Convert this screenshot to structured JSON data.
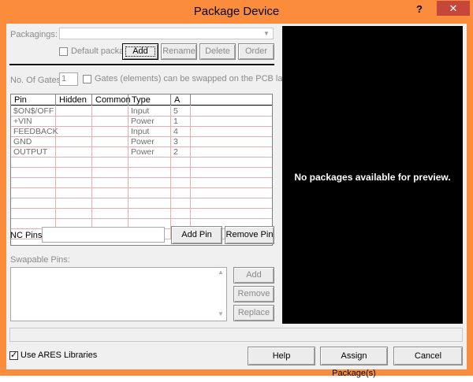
{
  "window": {
    "title": "Package Device",
    "help_symbol": "?",
    "close_symbol": "✕"
  },
  "packagings": {
    "label": "Packagings:",
    "value": "",
    "default_package_label": "Default package",
    "buttons": {
      "add": "Add",
      "rename": "Rename",
      "delete": "Delete",
      "order": "Order"
    }
  },
  "gates": {
    "label": "No. Of Gates:",
    "value": "1",
    "swap_label": "Gates (elements) can be swapped on the PCB layout?"
  },
  "pin_table": {
    "columns": [
      "Pin",
      "Hidden",
      "Common",
      "Type",
      "A"
    ],
    "rows": [
      {
        "pin": "$ON$/OFF",
        "hidden": "",
        "common": "",
        "type": "Input",
        "a": "5"
      },
      {
        "pin": "+VIN",
        "hidden": "",
        "common": "",
        "type": "Power",
        "a": "1"
      },
      {
        "pin": "FEEDBACK",
        "hidden": "",
        "common": "",
        "type": "Input",
        "a": "4"
      },
      {
        "pin": "GND",
        "hidden": "",
        "common": "",
        "type": "Power",
        "a": "3"
      },
      {
        "pin": "OUTPUT",
        "hidden": "",
        "common": "",
        "type": "Power",
        "a": "2"
      }
    ]
  },
  "nc_pins": {
    "label": "NC Pins:",
    "value": "",
    "add_pin": "Add Pin",
    "remove_pin": "Remove Pin"
  },
  "swapable": {
    "label": "Swapable Pins:",
    "add": "Add",
    "remove": "Remove",
    "replace": "Replace"
  },
  "preview": {
    "message": "No packages available for preview."
  },
  "footer": {
    "use_ares_label": "Use ARES Libraries",
    "use_ares_checked": true,
    "help": "Help",
    "assign": "Assign Package(s)",
    "cancel": "Cancel"
  },
  "colors": {
    "titlebar": "#fb8c3c",
    "close_button": "#c7463a",
    "grid_lines": "#e7aeb1",
    "preview_bg": "#000000"
  }
}
